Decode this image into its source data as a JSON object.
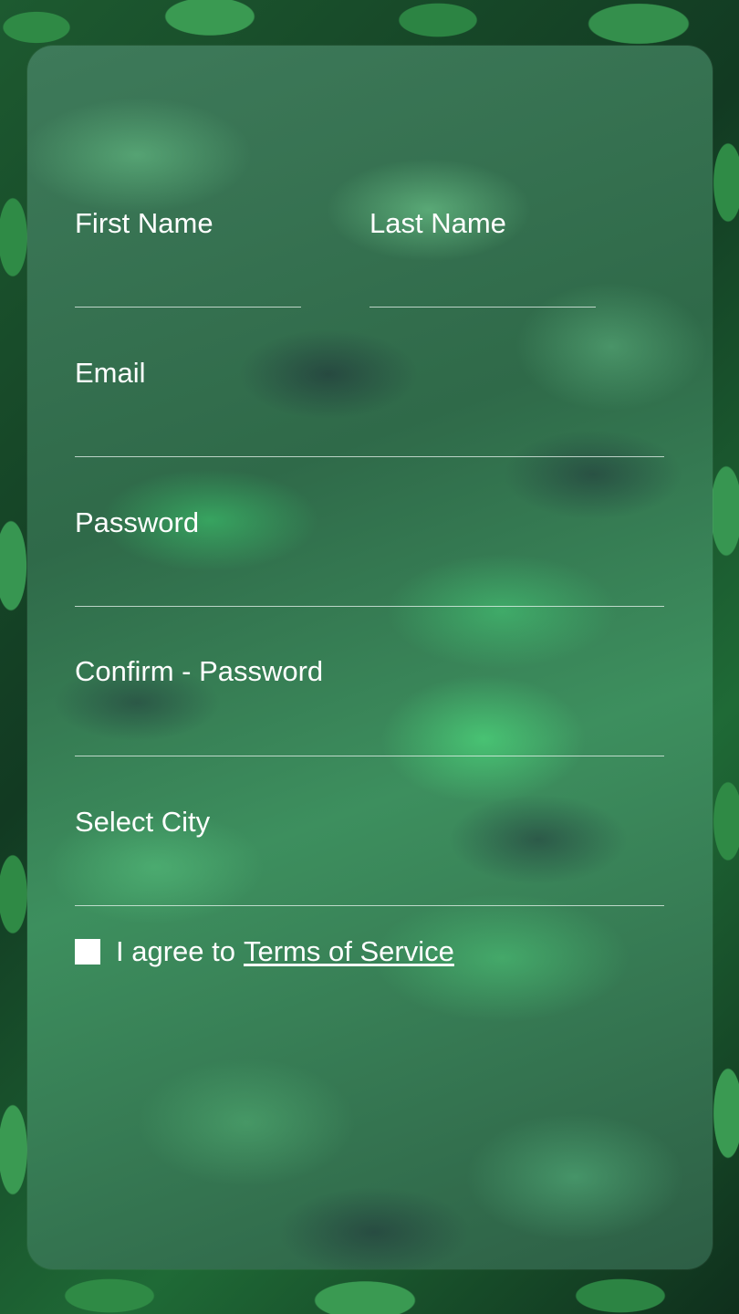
{
  "form": {
    "first_name": {
      "label": "First Name",
      "value": ""
    },
    "last_name": {
      "label": "Last Name",
      "value": ""
    },
    "email": {
      "label": "Email",
      "value": ""
    },
    "password": {
      "label": "Password",
      "value": ""
    },
    "confirm_password": {
      "label": "Confirm - Password",
      "value": ""
    },
    "city": {
      "label": "Select City",
      "value": ""
    },
    "agree": {
      "checked": false,
      "text": "I agree to",
      "link_text": "Terms of Service"
    }
  }
}
